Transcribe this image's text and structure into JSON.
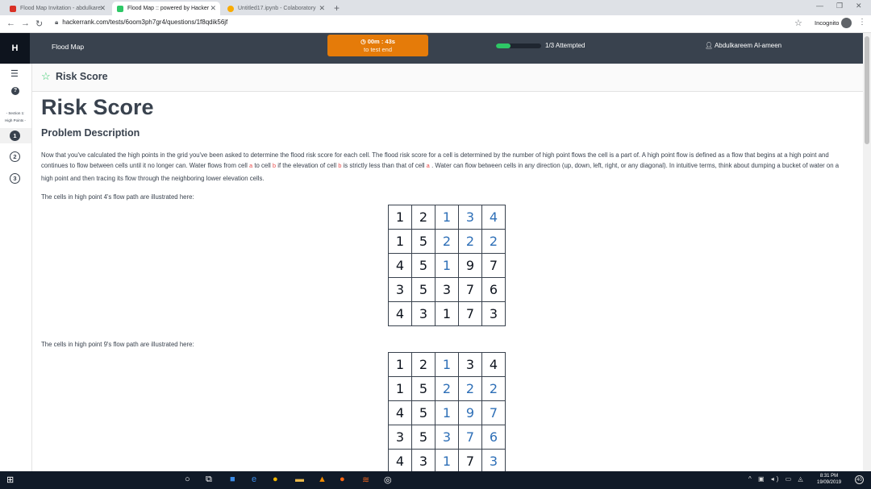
{
  "browser": {
    "tabs": [
      {
        "title": "Flood Map Invitation - abdulkare",
        "fav_color": "#d93025"
      },
      {
        "title": "Flood Map :: powered by Hacker",
        "fav_color": "#2ec866"
      },
      {
        "title": "Untitled17.ipynb - Colaboratory",
        "fav_color": "#f9ab00"
      }
    ],
    "new_tab": "+",
    "url": "hackerrank.com/tests/6oom3ph7gr4/questions/1f8qdik56jf",
    "incognito_label": "Incognito"
  },
  "header": {
    "logo": "H",
    "problem_name": "Flood Map",
    "timer_value": "00m : 43s",
    "timer_caption": "to test end",
    "progress_fraction": 0.33,
    "attempted": "1/3 Attempted",
    "user": "Abdulkareem Al-ameen"
  },
  "rail": {
    "section_line1": "- Section 1:",
    "section_line2": "High Points -",
    "questions": [
      "1",
      "2",
      "3"
    ]
  },
  "main": {
    "breadcrumb_title": "Risk Score",
    "title": "Risk Score",
    "section_heading": "Problem Description",
    "para": {
      "p1": "Now that you've calculated the high points in the grid you've been asked to determine the flood risk score for each cell. The flood risk score for a cell is determined by the number of high point flows the cell is a part of. A high point flow is defined as a flow that begins at a high point and continues to flow between cells until it no longer can. Water flows from cell",
      "code_a": "a",
      "p2": "to cell",
      "code_b": "b",
      "p3": "if the elevation of cell",
      "code_b2": "b",
      "p4": "is strictly less than that of cell",
      "code_a2": "a",
      "p5": ". Water can flow between cells in any direction (up, down, left, right, or any diagonal). In intuitive terms, think about dumping a bucket of water on a high point and then tracing its flow through the neighboring lower elevation cells."
    },
    "caption1": "The cells in high point 4's flow path are illustrated here:",
    "caption2": "The cells in high point 9's flow path are illustrated here:",
    "highlight_color": "#2e6fb7",
    "grid1": [
      [
        {
          "v": "1",
          "h": false
        },
        {
          "v": "2",
          "h": false
        },
        {
          "v": "1",
          "h": true
        },
        {
          "v": "3",
          "h": true
        },
        {
          "v": "4",
          "h": true
        }
      ],
      [
        {
          "v": "1",
          "h": false
        },
        {
          "v": "5",
          "h": false
        },
        {
          "v": "2",
          "h": true
        },
        {
          "v": "2",
          "h": true
        },
        {
          "v": "2",
          "h": true
        }
      ],
      [
        {
          "v": "4",
          "h": false
        },
        {
          "v": "5",
          "h": false
        },
        {
          "v": "1",
          "h": true
        },
        {
          "v": "9",
          "h": false
        },
        {
          "v": "7",
          "h": false
        }
      ],
      [
        {
          "v": "3",
          "h": false
        },
        {
          "v": "5",
          "h": false
        },
        {
          "v": "3",
          "h": false
        },
        {
          "v": "7",
          "h": false
        },
        {
          "v": "6",
          "h": false
        }
      ],
      [
        {
          "v": "4",
          "h": false
        },
        {
          "v": "3",
          "h": false
        },
        {
          "v": "1",
          "h": false
        },
        {
          "v": "7",
          "h": false
        },
        {
          "v": "3",
          "h": false
        }
      ]
    ],
    "grid2": [
      [
        {
          "v": "1",
          "h": false
        },
        {
          "v": "2",
          "h": false
        },
        {
          "v": "1",
          "h": true
        },
        {
          "v": "3",
          "h": false
        },
        {
          "v": "4",
          "h": false
        }
      ],
      [
        {
          "v": "1",
          "h": false
        },
        {
          "v": "5",
          "h": false
        },
        {
          "v": "2",
          "h": true
        },
        {
          "v": "2",
          "h": true
        },
        {
          "v": "2",
          "h": true
        }
      ],
      [
        {
          "v": "4",
          "h": false
        },
        {
          "v": "5",
          "h": false
        },
        {
          "v": "1",
          "h": true
        },
        {
          "v": "9",
          "h": true
        },
        {
          "v": "7",
          "h": true
        }
      ],
      [
        {
          "v": "3",
          "h": false
        },
        {
          "v": "5",
          "h": false
        },
        {
          "v": "3",
          "h": true
        },
        {
          "v": "7",
          "h": true
        },
        {
          "v": "6",
          "h": true
        }
      ],
      [
        {
          "v": "4",
          "h": false
        },
        {
          "v": "3",
          "h": false
        },
        {
          "v": "1",
          "h": true
        },
        {
          "v": "7",
          "h": false
        },
        {
          "v": "3",
          "h": true
        }
      ]
    ]
  },
  "taskbar": {
    "time": "8:31 PM",
    "date": "19/09/2019",
    "notif_count": "40"
  }
}
